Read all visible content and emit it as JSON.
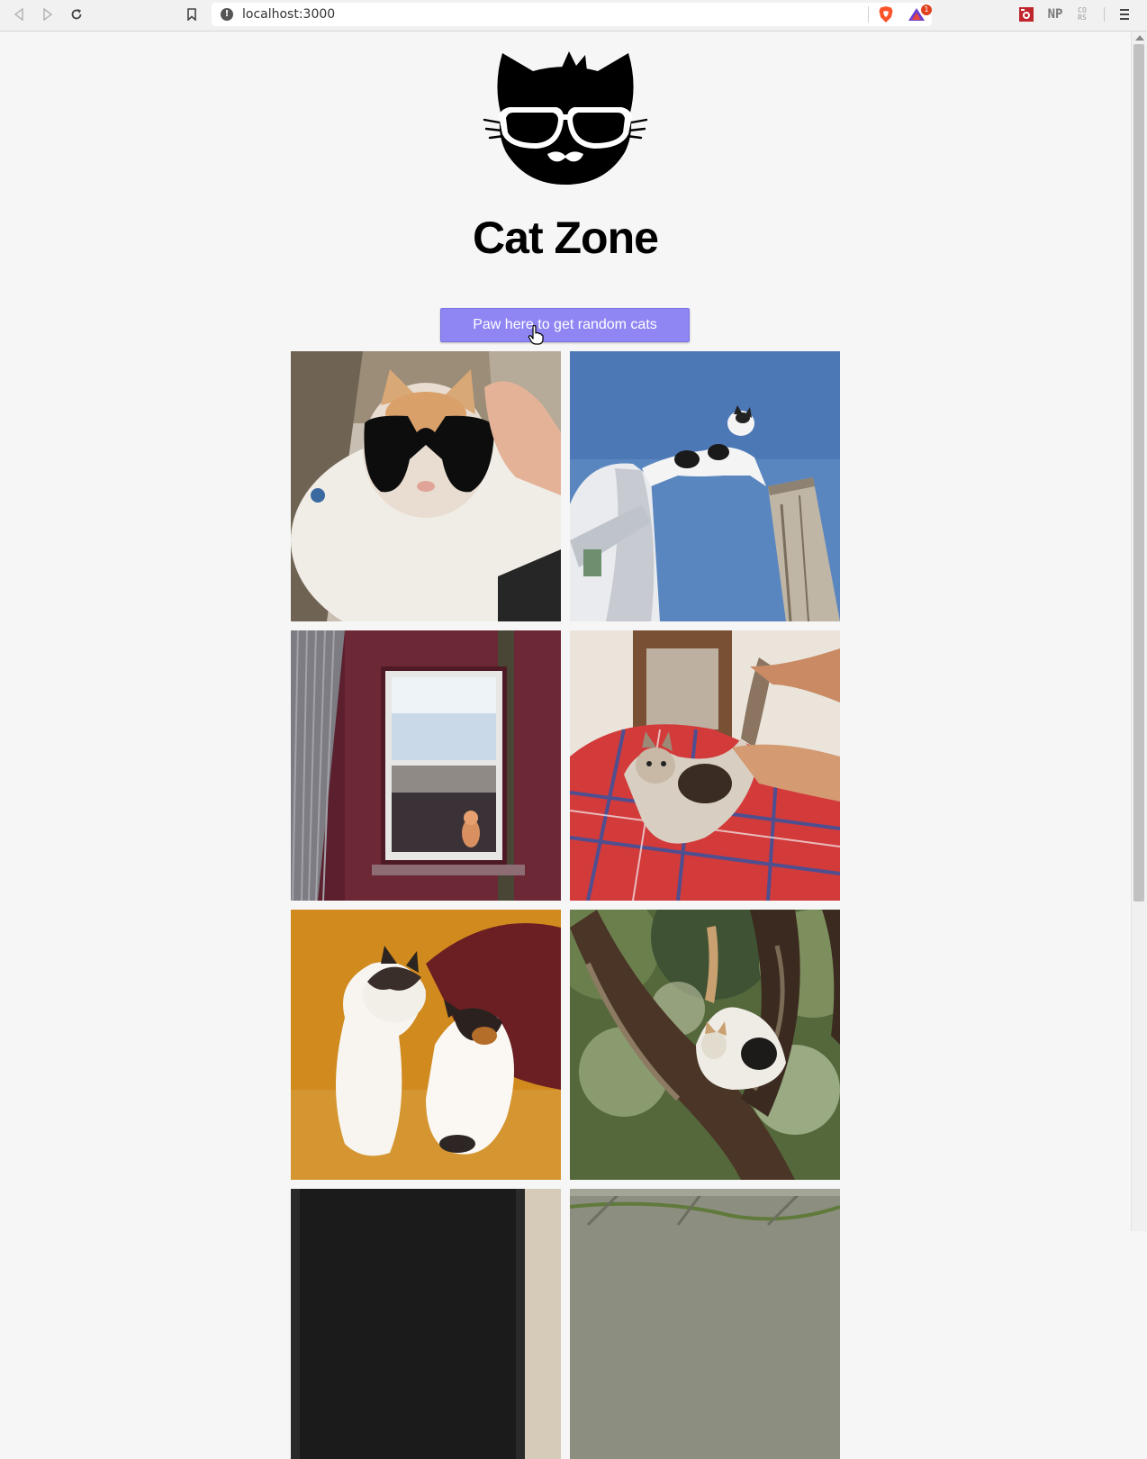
{
  "browser": {
    "url": "localhost:3000",
    "rewards_count": "1",
    "extensions": [
      "NP",
      "CO\nRS"
    ]
  },
  "page": {
    "title": "Cat Zone",
    "button_label": "Paw here to get random cats"
  },
  "gallery": {
    "images": [
      {
        "subject": "white cat wearing sunglasses"
      },
      {
        "subject": "cat leaping from a wooden post against blue sky"
      },
      {
        "subject": "cat sitting in a window of a red brick wall"
      },
      {
        "subject": "cat on red plaid blanket playing with hands"
      },
      {
        "subject": "two calico kittens on yellow couch"
      },
      {
        "subject": "cat climbing a tree"
      },
      {
        "subject": "partially visible cat photo"
      },
      {
        "subject": "partially visible cat photo on pavement"
      }
    ]
  },
  "colors": {
    "button": "#8f86f4",
    "background": "#f6f6f6"
  }
}
